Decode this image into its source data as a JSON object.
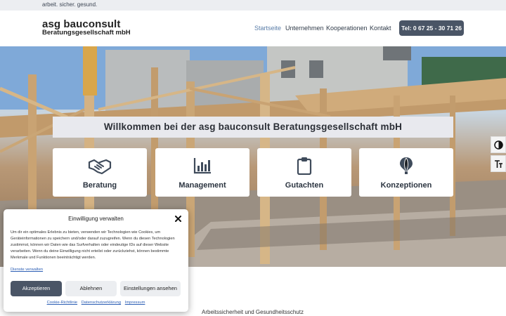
{
  "topbar": {
    "tagline": "arbeit. sicher. gesund."
  },
  "header": {
    "logo_main": "asg bauconsult",
    "logo_sub": "Beratungsgesellschaft mbH",
    "nav": [
      "Startseite",
      "Unternehmen",
      "Kooperationen",
      "Kontakt"
    ],
    "active_nav": "Startseite",
    "phone_button": "Tel: 0 67 25 - 30 71 26"
  },
  "hero": {
    "welcome": "Willkommen bei der asg bauconsult Beratungsgesellschaft mbH",
    "cards": [
      {
        "label": "Beratung",
        "icon": "handshake-icon"
      },
      {
        "label": "Management",
        "icon": "bar-chart-icon"
      },
      {
        "label": "Gutachten",
        "icon": "clipboard-icon"
      },
      {
        "label": "Konzeptionen",
        "icon": "hot-air-balloon-icon"
      }
    ]
  },
  "accessibility": {
    "icons": [
      "contrast-icon",
      "text-size-icon"
    ]
  },
  "section": {
    "text": "Arbeitssicherheit und Gesundheitsschutz"
  },
  "cookie": {
    "title": "Einwilligung verwalten",
    "body": "Um dir ein optimales Erlebnis zu bieten, verwenden wir Technologien wie Cookies, um Geräteinformationen zu speichern und/oder darauf zuzugreifen. Wenn du diesen Technologien zustimmst, können wir Daten wie das Surfverhalten oder eindeutige IDs auf dieser Website verarbeiten. Wenn du deine Einwilligung nicht erteilst oder zurückziehst, können bestimmte Merkmale und Funktionen beeinträchtigt werden.",
    "manage_link": "Dienste verwalten",
    "accept": "Akzeptieren",
    "deny": "Ablehnen",
    "preferences": "Einstellungen ansehen",
    "links": [
      "Cookie-Richtlinie",
      "Datenschutzerklärung",
      "Impressum"
    ]
  },
  "colors": {
    "primary": "#4a5566",
    "nav_active": "#5a7da8",
    "link": "#2d5fb5"
  }
}
